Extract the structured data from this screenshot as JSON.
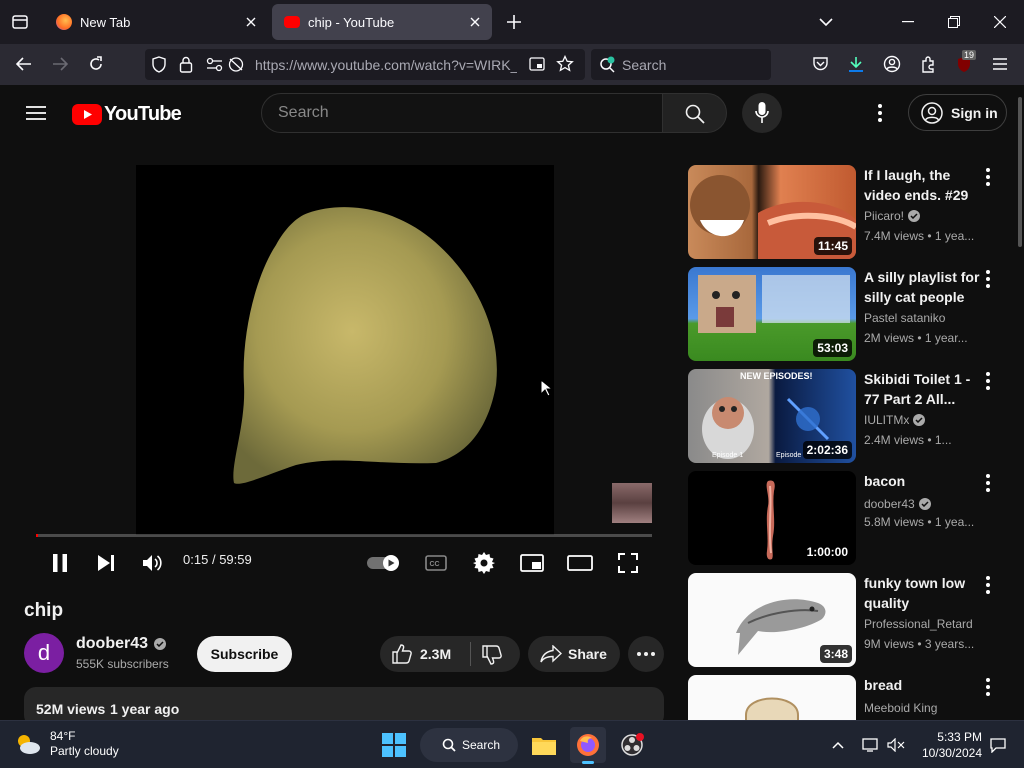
{
  "browser": {
    "tabs": [
      {
        "label": "New Tab",
        "icon": "firefox-icon",
        "active": false
      },
      {
        "label": "chip - YouTube",
        "icon": "youtube-icon",
        "active": true
      }
    ],
    "url": "https://www.youtube.com/watch?v=WIRK_",
    "search_placeholder": "Search",
    "extension_badge": "19"
  },
  "youtube": {
    "logo_text": "YouTube",
    "search_placeholder": "Search",
    "sign_in_label": "Sign in"
  },
  "player": {
    "time_current": "0:15",
    "time_separator": "/",
    "time_total": "59:59",
    "progress_fraction": 0.004
  },
  "video": {
    "title": "chip",
    "channel_initial": "d",
    "channel_name": "doober43",
    "subscribers": "555K subscribers",
    "subscribe_label": "Subscribe",
    "likes": "2.3M",
    "share_label": "Share",
    "views": "52M views",
    "age": "1 year ago"
  },
  "recommendations": [
    {
      "title": "If I laugh, the video ends. #29",
      "channel": "Piicaro!",
      "verified": true,
      "meta": "7.4M views • 1 yea...",
      "duration": "11:45"
    },
    {
      "title": "A silly playlist for silly cat people",
      "channel": "Pastel sataniko",
      "verified": false,
      "meta": "2M views • 1 year...",
      "duration": "53:03"
    },
    {
      "title": "Skibidi Toilet 1 - 77 Part 2 All...",
      "channel": "IULITMx",
      "verified": true,
      "meta": "2.4M views • 1...",
      "duration": "2:02:36"
    },
    {
      "title": "bacon",
      "channel": "doober43",
      "verified": true,
      "meta": "5.8M views • 1 yea...",
      "duration": "1:00:00"
    },
    {
      "title": "funky town low quality",
      "channel": "Professional_Retard",
      "verified": false,
      "meta": "9M views • 3 years...",
      "duration": "3:48"
    },
    {
      "title": "bread",
      "channel": "Meeboid King",
      "verified": false,
      "meta": "",
      "duration": ""
    }
  ],
  "thumb_texts": {
    "skibidi_top": "NEW EPISODES!",
    "skibidi_left": "Episode 1",
    "skibidi_right": "Episode"
  },
  "taskbar": {
    "weather_temp": "84°F",
    "weather_desc": "Partly cloudy",
    "search_label": "Search",
    "time": "5:33 PM",
    "date": "10/30/2024"
  },
  "colors": {
    "accent_red": "#ff0000",
    "background": "#0f0f0f",
    "firefox_blue": "#0a84ff"
  }
}
